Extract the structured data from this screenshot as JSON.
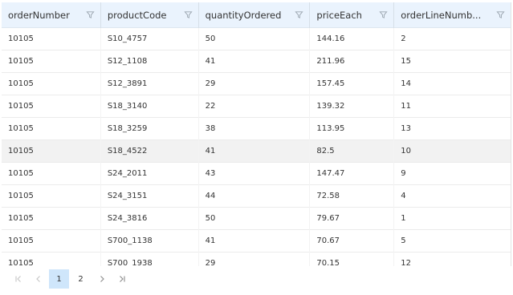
{
  "columns": [
    {
      "label": "orderNumber"
    },
    {
      "label": "productCode"
    },
    {
      "label": "quantityOrdered"
    },
    {
      "label": "priceEach"
    },
    {
      "label": "orderLineNumb..."
    }
  ],
  "rows": [
    [
      "10105",
      "S10_4757",
      "50",
      "144.16",
      "2"
    ],
    [
      "10105",
      "S12_1108",
      "41",
      "211.96",
      "15"
    ],
    [
      "10105",
      "S12_3891",
      "29",
      "157.45",
      "14"
    ],
    [
      "10105",
      "S18_3140",
      "22",
      "139.32",
      "11"
    ],
    [
      "10105",
      "S18_3259",
      "38",
      "113.95",
      "13"
    ],
    [
      "10105",
      "S18_4522",
      "41",
      "82.5",
      "10"
    ],
    [
      "10105",
      "S24_2011",
      "43",
      "147.47",
      "9"
    ],
    [
      "10105",
      "S24_3151",
      "44",
      "72.58",
      "4"
    ],
    [
      "10105",
      "S24_3816",
      "50",
      "79.67",
      "1"
    ],
    [
      "10105",
      "S700_1138",
      "41",
      "70.67",
      "5"
    ],
    [
      "10105",
      "S700_1938",
      "29",
      "70.15",
      "12"
    ]
  ],
  "highlighted_row": 5,
  "pager": {
    "pages": [
      "1",
      "2"
    ],
    "current": "1",
    "icons": [
      "first-page-icon",
      "prev-page-icon",
      "next-page-icon",
      "last-page-icon"
    ]
  },
  "colors": {
    "header_bg": "#eaf3fd",
    "active_page_bg": "#cfe6fb",
    "highlight_row_bg": "#f2f2f2"
  }
}
